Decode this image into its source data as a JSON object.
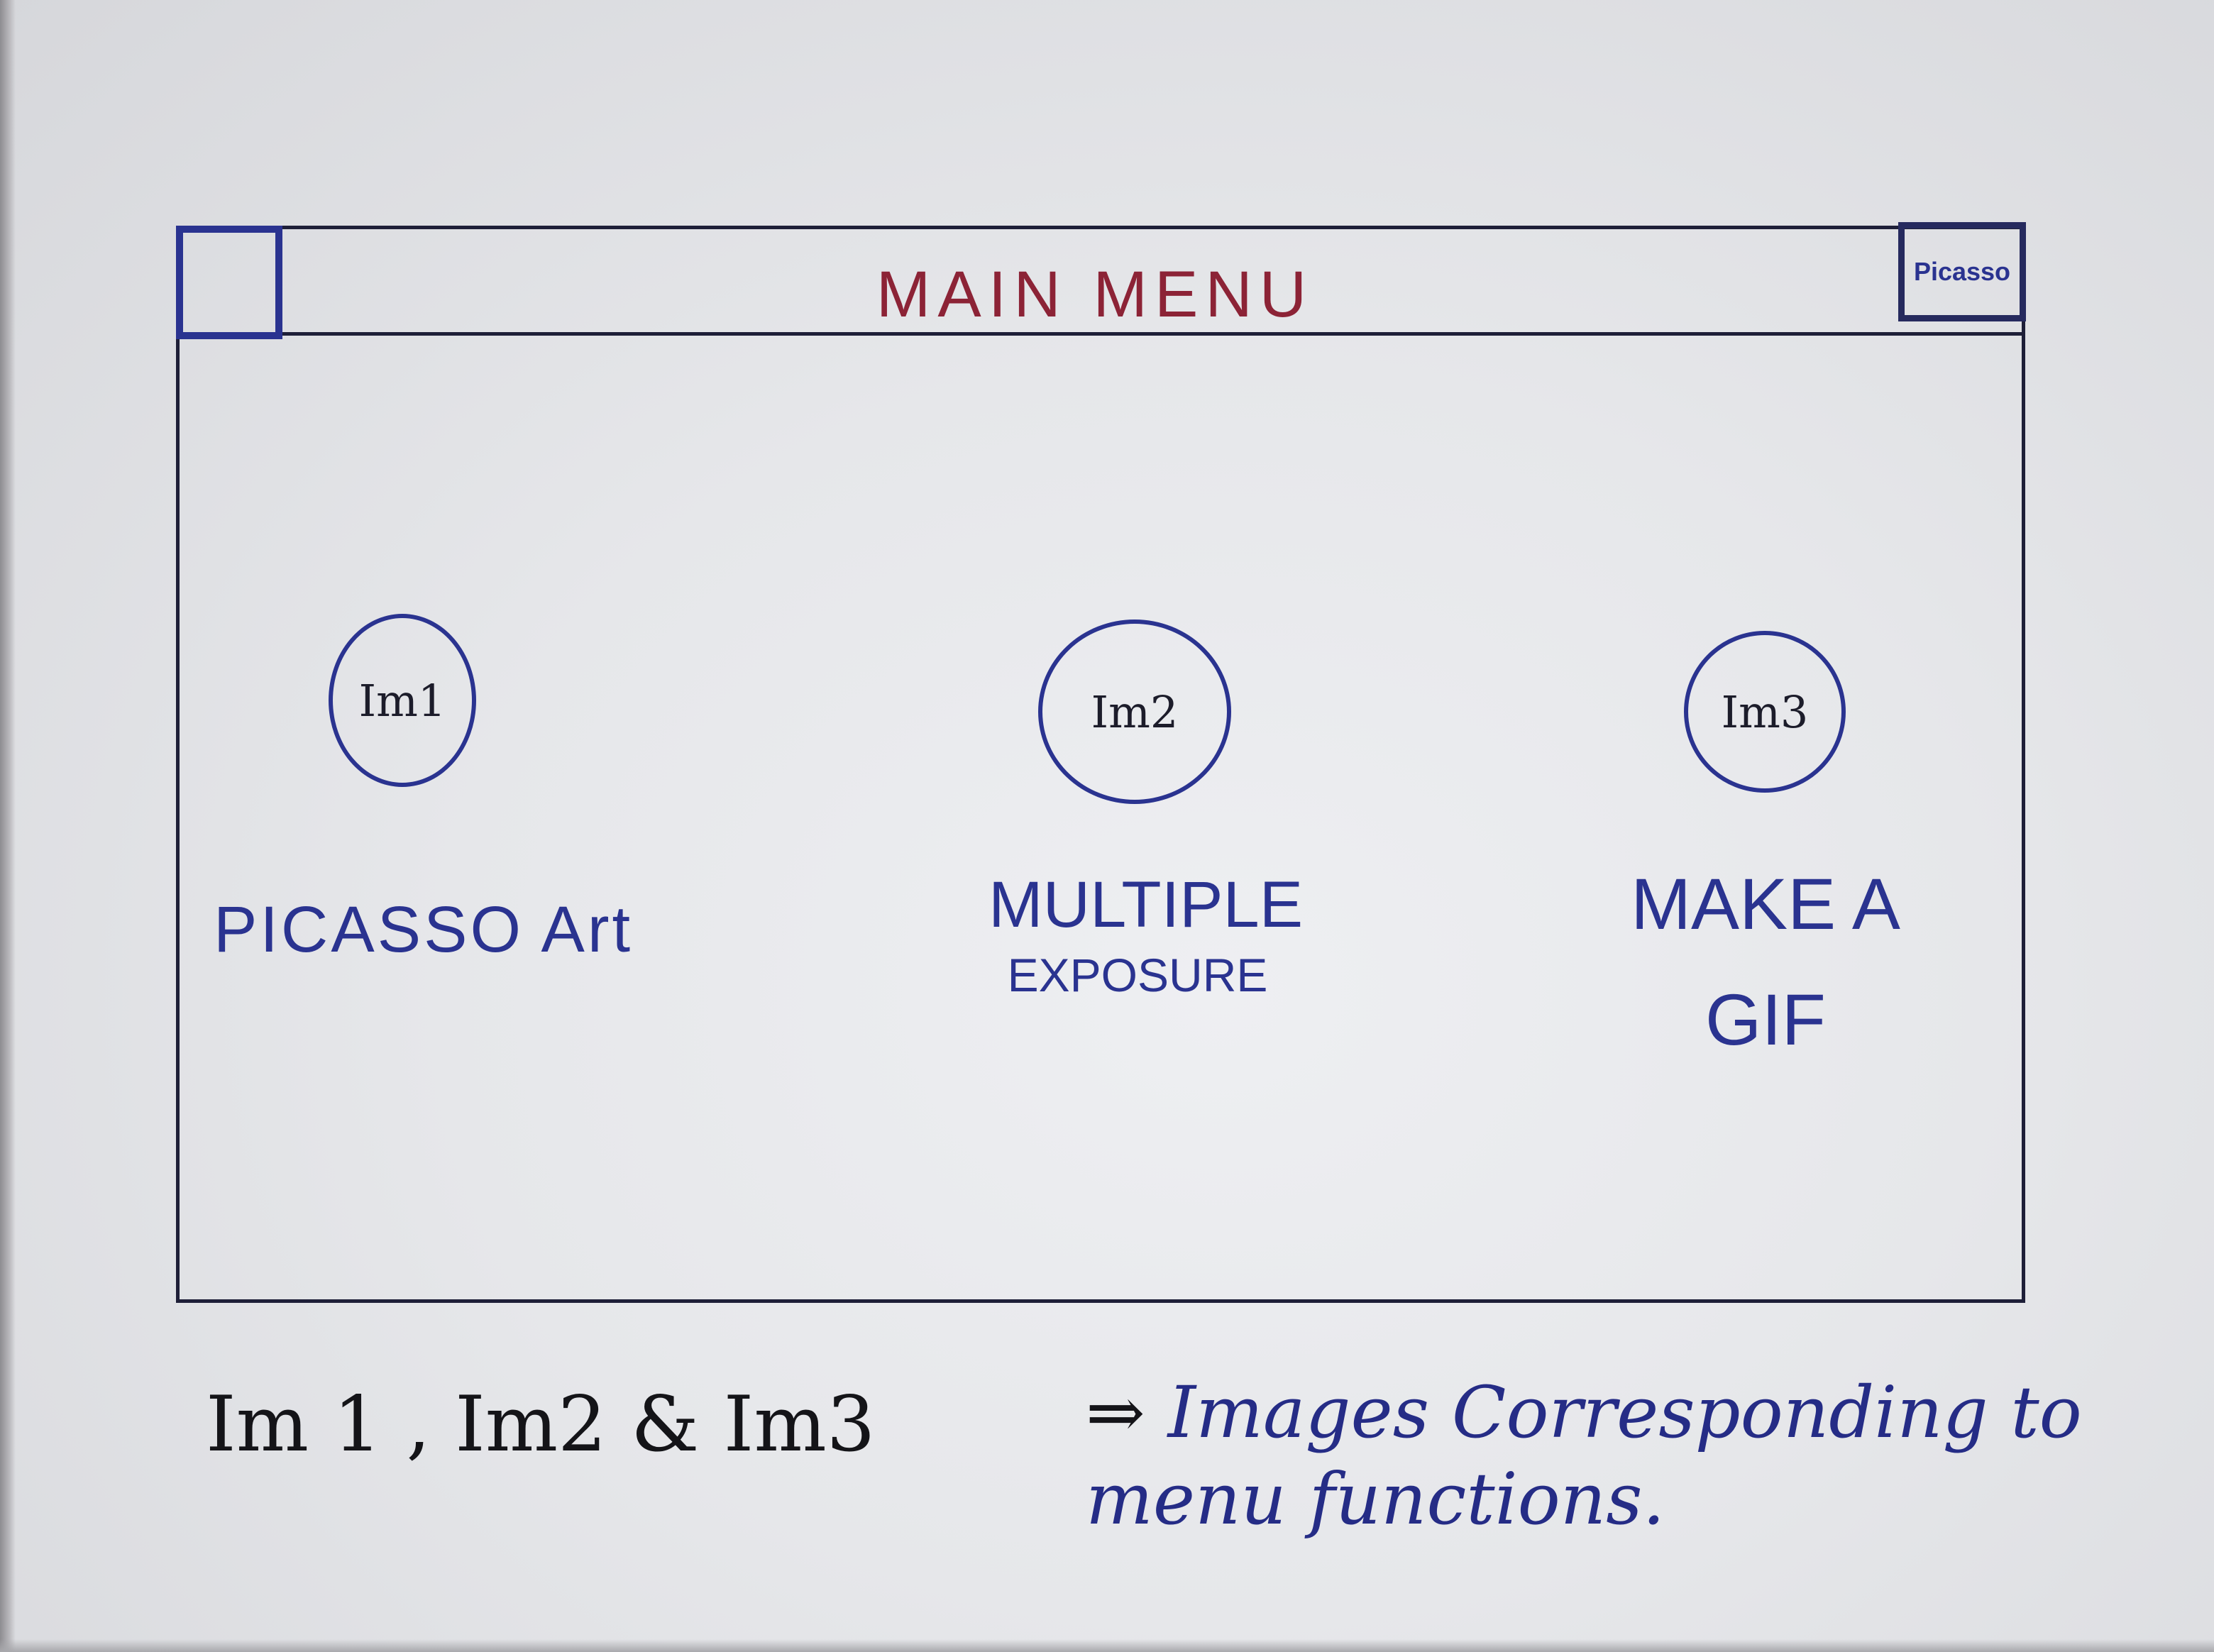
{
  "window": {
    "title": "MAIN MENU",
    "corner_button_label": "Picasso"
  },
  "menu_items": [
    {
      "image_label": "Im1",
      "label_lines": [
        "PICASSO Art"
      ]
    },
    {
      "image_label": "Im2",
      "label_lines": [
        "MULTIPLE",
        "EXPOSURE"
      ]
    },
    {
      "image_label": "Im3",
      "label_lines": [
        "MAKE A",
        "GIF"
      ]
    }
  ],
  "note": {
    "left": "Im 1 , Im2 & Im3",
    "arrow": "⇒",
    "right": "Images Corresponding to menu functions."
  },
  "colors": {
    "frame": "#1e1f38",
    "accent_blue": "#2a3390",
    "title_red": "#8c2336"
  },
  "icons": {
    "corner": "square-icon",
    "menu_images": "circle-image-icon"
  }
}
